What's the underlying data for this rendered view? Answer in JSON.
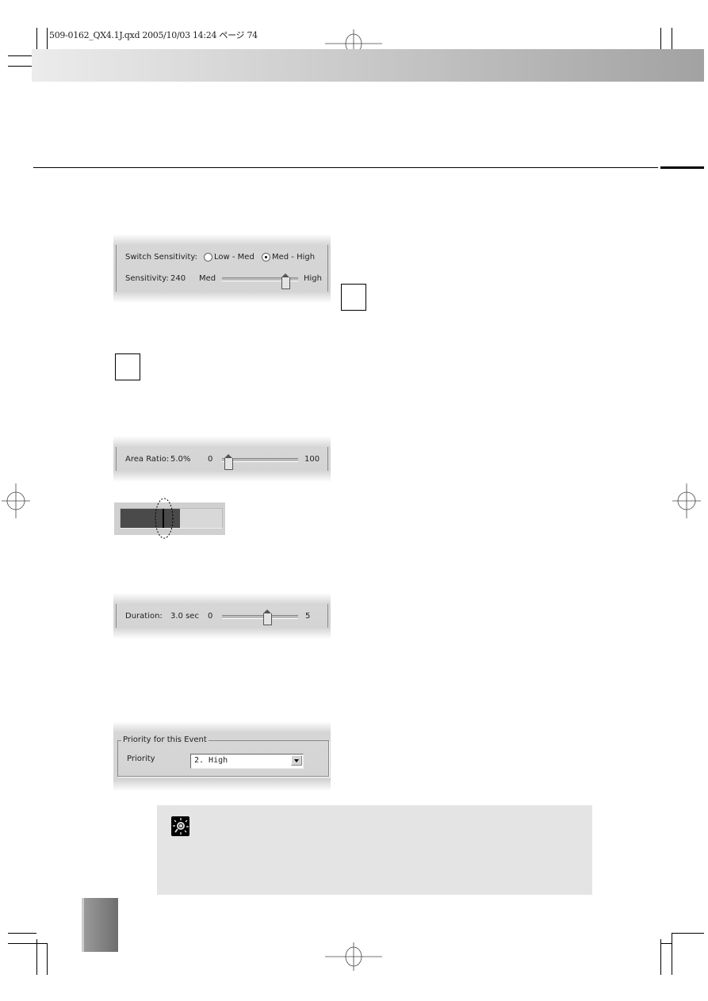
{
  "print_header": {
    "slug": "509-0162_QX4.1J.qxd  2005/10/03  14:24  ページ 74"
  },
  "panel_sensitivity": {
    "switch_label": "Switch Sensitivity:",
    "options": [
      {
        "label": "Low - Med",
        "selected": false
      },
      {
        "label": "Med - High",
        "selected": true
      }
    ],
    "sensitivity_label": "Sensitivity:",
    "sensitivity_value": "240",
    "min_label": "Med",
    "max_label": "High",
    "slider_position_percent": 85
  },
  "panel_area_ratio": {
    "label": "Area Ratio:",
    "value": "5.0%",
    "min_label": "0",
    "max_label": "100",
    "slider_value": 5
  },
  "level_bar": {
    "fill_percent": 59,
    "marker_percent": 45
  },
  "panel_duration": {
    "label": "Duration:",
    "value": "3.0 sec",
    "min_label": "0",
    "max_label": "5",
    "slider_value": 3
  },
  "panel_priority": {
    "group_title": "Priority for this Event",
    "label": "Priority",
    "selected": "2. High"
  },
  "tip_box": {
    "icon": "lightbulb-icon"
  }
}
